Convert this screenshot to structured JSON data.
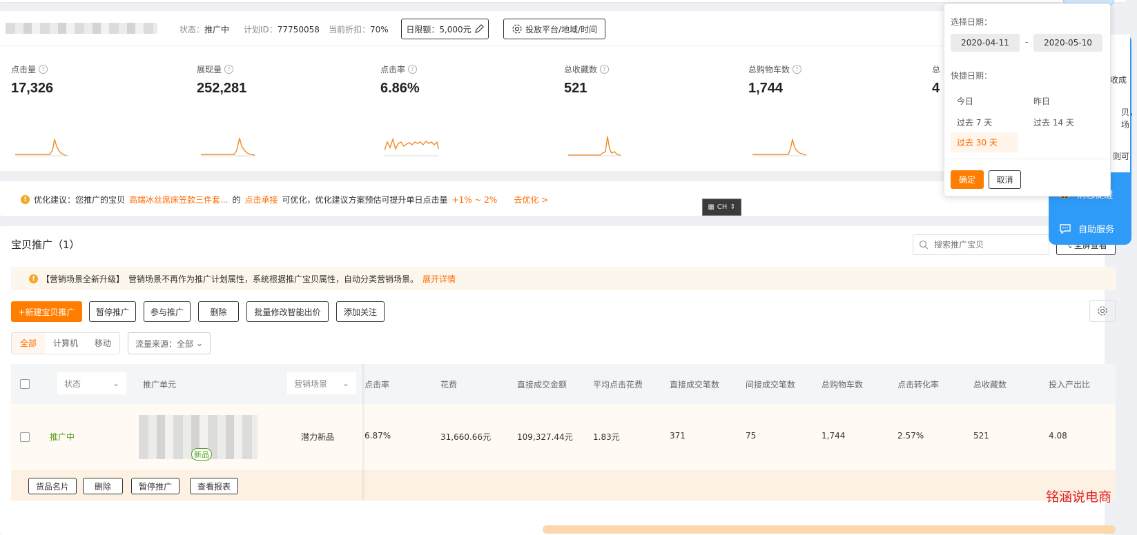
{
  "plan": {
    "status_label": "状态：",
    "status_value": "推广中",
    "plan_id_label": "计划ID：",
    "plan_id": "77750058",
    "discount_label": "当前折扣：",
    "discount": "70%",
    "daily_limit_label": "日限额：5,000元",
    "settings_label": "投放平台/地域/时间"
  },
  "metrics": [
    {
      "label": "点击量",
      "value": "17,326"
    },
    {
      "label": "展现量",
      "value": "252,281"
    },
    {
      "label": "点击率",
      "value": "6.86%"
    },
    {
      "label": "总收藏数",
      "value": "521"
    },
    {
      "label": "总购物车数",
      "value": "1,744"
    },
    {
      "label": "总",
      "value": "4"
    }
  ],
  "optimize": {
    "prefix": "优化建议：您推广的宝贝",
    "item": "高端冰丝席床笠款三件套...",
    "mid1": "的",
    "link1": "点击承接",
    "mid2": "可优化，优化建议方案预估可提升单日点击量",
    "range": "+1% ~ 2%",
    "action": "去优化 >"
  },
  "ime": {
    "text": "CH"
  },
  "list": {
    "title": "宝贝推广（1）",
    "search_placeholder": "搜索推广宝贝",
    "fullscreen_label": "全屏查看",
    "notice_tag": "【营销场景全新升级】",
    "notice_text": "营销场景不再作为推广计划属性，系统根据推广宝贝属性，自动分类营销场景。",
    "notice_link": "展开详情",
    "actions": [
      "+新建宝贝推广",
      "暂停推广",
      "参与推广",
      "删除",
      "批量修改智能出价",
      "添加关注"
    ],
    "segments": [
      "全部",
      "计算机",
      "移动"
    ],
    "traffic_source": "流量来源：全部",
    "columns": {
      "status": "状态",
      "unit": "推广单元",
      "scene": "营销场景",
      "ctr": "点击率",
      "cost": "花费",
      "direct_amount": "直接成交金额",
      "avg_cpc": "平均点击花费",
      "direct_orders": "直接成交笔数",
      "indirect_orders": "间接成交笔数",
      "carts": "总购物车数",
      "cvr": "点击转化率",
      "favs": "总收藏数",
      "roi": "投入产出比"
    },
    "row": {
      "status": "推广中",
      "badge": "新品",
      "scene": "潜力新品",
      "ctr": "6.87%",
      "cost": "31,660.66元",
      "direct_amount": "109,327.44元",
      "avg_cpc": "1.83元",
      "direct_orders": "371",
      "indirect_orders": "75",
      "carts": "1,744",
      "cvr": "2.57%",
      "favs": "521",
      "roi": "4.08"
    },
    "row_actions": [
      "货品名片",
      "删除",
      "暂停推广",
      "查看报表"
    ]
  },
  "date_picker": {
    "select_label": "选择日期：",
    "start": "2020-04-11",
    "sep": "-",
    "end": "2020-05-10",
    "quick_label": "快捷日期：",
    "quick": [
      "今日",
      "昨日",
      "过去 7 天",
      "过去 14 天",
      "过去 30 天"
    ],
    "selected": "过去 30 天",
    "confirm": "确定",
    "cancel": "取消"
  },
  "side": {
    "text1": "收成",
    "text2": "贝，",
    "text3": "场",
    "text4": "则可",
    "item1": "消息提醒",
    "item2": "自助服务"
  },
  "watermark": "铭涵说电商",
  "colors": {
    "accent": "#ff7d00",
    "side_blue": "#2f9bf8",
    "sparkline": "#f08a24",
    "status_green": "#52a01e"
  }
}
